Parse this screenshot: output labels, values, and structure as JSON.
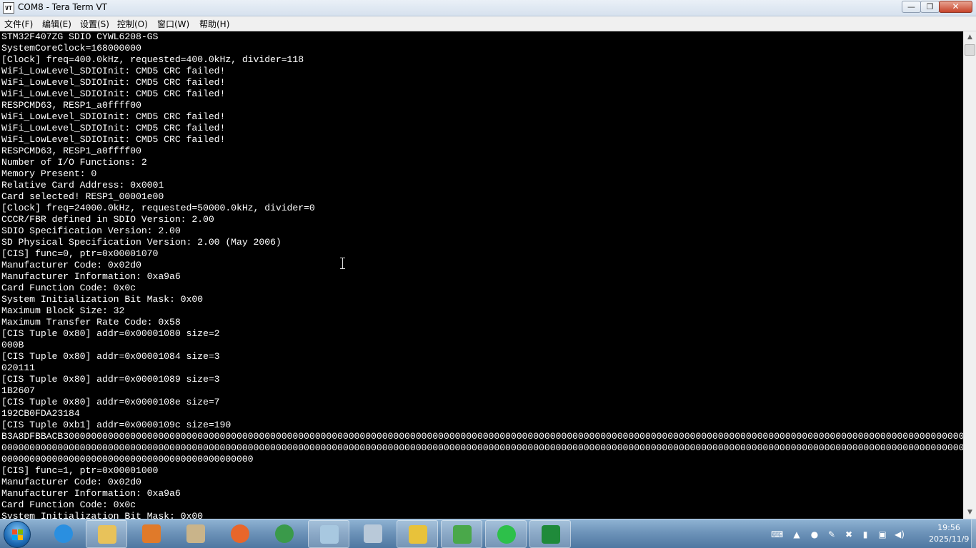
{
  "window": {
    "title": "COM8 - Tera Term VT",
    "icon_label": "VT",
    "minimize_glyph": "—",
    "maximize_glyph": "❐",
    "close_glyph": "✕"
  },
  "menu": {
    "items": [
      "文件(F)",
      "编辑(E)",
      "设置(S)",
      "控制(O)",
      "窗口(W)",
      "帮助(H)"
    ]
  },
  "terminal": {
    "lines": [
      "STM32F407ZG SDIO CYWL6208-GS",
      "SystemCoreClock=168000000",
      "[Clock] freq=400.0kHz, requested=400.0kHz, divider=118",
      "WiFi_LowLevel_SDIOInit: CMD5 CRC failed!",
      "WiFi_LowLevel_SDIOInit: CMD5 CRC failed!",
      "WiFi_LowLevel_SDIOInit: CMD5 CRC failed!",
      "RESPCMD63, RESP1_a0ffff00",
      "WiFi_LowLevel_SDIOInit: CMD5 CRC failed!",
      "WiFi_LowLevel_SDIOInit: CMD5 CRC failed!",
      "WiFi_LowLevel_SDIOInit: CMD5 CRC failed!",
      "RESPCMD63, RESP1_a0ffff00",
      "Number of I/O Functions: 2",
      "Memory Present: 0",
      "Relative Card Address: 0x0001",
      "Card selected! RESP1_00001e00",
      "[Clock] freq=24000.0kHz, requested=50000.0kHz, divider=0",
      "CCCR/FBR defined in SDIO Version: 2.00",
      "SDIO Specification Version: 2.00",
      "SD Physical Specification Version: 2.00 (May 2006)",
      "[CIS] func=0, ptr=0x00001070",
      "Manufacturer Code: 0x02d0",
      "Manufacturer Information: 0xa9a6",
      "Card Function Code: 0x0c",
      "System Initialization Bit Mask: 0x00",
      "Maximum Block Size: 32",
      "Maximum Transfer Rate Code: 0x58",
      "[CIS Tuple 0x80] addr=0x00001080 size=2",
      "000B",
      "[CIS Tuple 0x80] addr=0x00001084 size=3",
      "020111",
      "[CIS Tuple 0x80] addr=0x00001089 size=3",
      "1B2607",
      "[CIS Tuple 0x80] addr=0x0000108e size=7",
      "192CB0FDA23184",
      "[CIS Tuple 0xb1] addr=0x0000109c size=190",
      "B3A8DFBBACB30000000000000000000000000000000000000000000000000000000000000000000000000000000000000000000000000000000000000000000000000000000000000000000000000000000000000000",
      "0000000000000000000000000000000000000000000000000000000000000000000000000000000000000000000000000000000000000000000000000000000000000000000000000000000000000000000000000000",
      "000000000000000000000000000000000000000000000",
      "[CIS] func=1, ptr=0x00001000",
      "Manufacturer Code: 0x02d0",
      "Manufacturer Information: 0xa9a6",
      "Card Function Code: 0x0c",
      "System Initialization Bit Mask: 0x00"
    ]
  },
  "scrollbar": {
    "up_glyph": "▲",
    "down_glyph": "▼"
  },
  "taskbar": {
    "apps": [
      {
        "name": "internet-explorer",
        "color": "#2a8fe0"
      },
      {
        "name": "file-explorer",
        "color": "#e8c25a"
      },
      {
        "name": "media-player",
        "color": "#e07a2a"
      },
      {
        "name": "paint",
        "color": "#c9b48a"
      },
      {
        "name": "firefox",
        "color": "#e8662a"
      },
      {
        "name": "chrome",
        "color": "#3a9a4a"
      },
      {
        "name": "notepad",
        "color": "#a8c8e0"
      },
      {
        "name": "calculator",
        "color": "#b9c9d9"
      },
      {
        "name": "tera-term",
        "color": "#e8c23a"
      },
      {
        "name": "editor",
        "color": "#4aa84a"
      },
      {
        "name": "wechat",
        "color": "#2dc04a"
      },
      {
        "name": "vim",
        "color": "#1f8a3a"
      }
    ],
    "tray_glyphs": [
      "⌨",
      "▲",
      "●",
      "✎",
      "✖",
      "▮",
      "▣",
      "◀)"
    ],
    "clock_time": "19:56",
    "clock_date": "2025/11/9"
  }
}
